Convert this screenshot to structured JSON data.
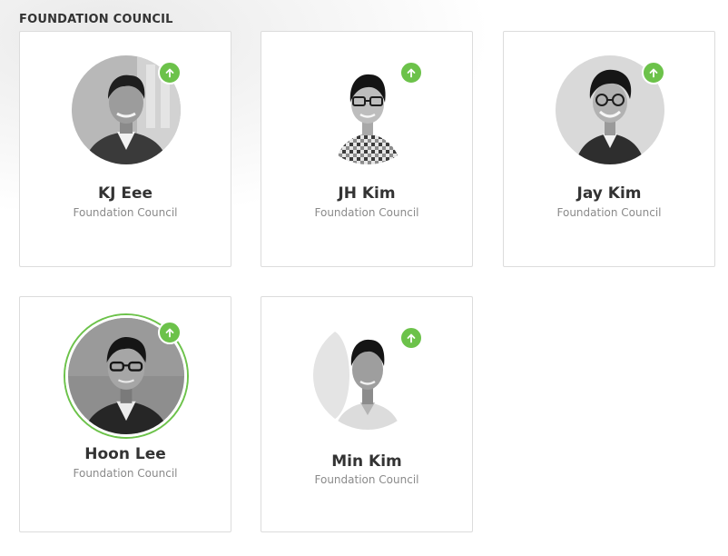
{
  "section": {
    "title": "FOUNDATION COUNCIL"
  },
  "accent_color": "#6cc24a",
  "badge_icon": "arrow-up-icon",
  "members": [
    {
      "name": "KJ Eee",
      "role": "Foundation Council"
    },
    {
      "name": "JH Kim",
      "role": "Foundation Council"
    },
    {
      "name": "Jay Kim",
      "role": "Foundation Council"
    },
    {
      "name": "Hoon Lee",
      "role": "Foundation Council",
      "hovered": true
    },
    {
      "name": "Min Kim",
      "role": "Foundation Council"
    }
  ]
}
